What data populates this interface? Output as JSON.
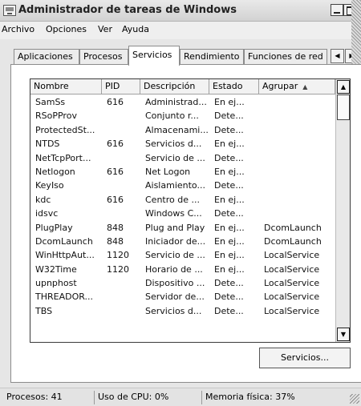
{
  "window": {
    "title": "Administrador de tareas de Windows",
    "controls": {
      "minimize": "",
      "maximize": "",
      "close": "X"
    }
  },
  "menu": [
    "Archivo",
    "Opciones",
    "Ver",
    "Ayuda"
  ],
  "tabs": {
    "items": [
      "Aplicaciones",
      "Procesos",
      "Servicios",
      "Rendimiento",
      "Funciones de red"
    ],
    "active": "Servicios",
    "scroll_left": "◀",
    "scroll_right": "▶"
  },
  "services_table": {
    "headers": [
      "Nombre",
      "PID",
      "Descripción",
      "Estado",
      "Agrupar"
    ],
    "sort_indicator": "▲",
    "rows": [
      [
        "SamSs",
        "616",
        "Administrad...",
        "En ej...",
        ""
      ],
      [
        "RSoPProv",
        "",
        "Conjunto r...",
        "Dete...",
        ""
      ],
      [
        "ProtectedSt...",
        "",
        "Almacenami...",
        "Dete...",
        ""
      ],
      [
        "NTDS",
        "616",
        "Servicios d...",
        "En ej...",
        ""
      ],
      [
        "NetTcpPort...",
        "",
        "Servicio de ...",
        "Dete...",
        ""
      ],
      [
        "Netlogon",
        "616",
        "Net Logon",
        "En ej...",
        ""
      ],
      [
        "KeyIso",
        "",
        "Aislamiento...",
        "Dete...",
        ""
      ],
      [
        "kdc",
        "616",
        "Centro de ...",
        "En ej...",
        ""
      ],
      [
        "idsvc",
        "",
        "Windows C...",
        "Dete...",
        ""
      ],
      [
        "PlugPlay",
        "848",
        "Plug and Play",
        "En ej...",
        "DcomLaunch"
      ],
      [
        "DcomLaunch",
        "848",
        "Iniciador de...",
        "En ej...",
        "DcomLaunch"
      ],
      [
        "WinHttpAut...",
        "1120",
        "Servicio de ...",
        "En ej...",
        "LocalService"
      ],
      [
        "W32Time",
        "1120",
        "Horario de ...",
        "En ej...",
        "LocalService"
      ],
      [
        "upnphost",
        "",
        "Dispositivo ...",
        "Dete...",
        "LocalService"
      ],
      [
        "THREADOR...",
        "",
        "Servidor de...",
        "Dete...",
        "LocalService"
      ],
      [
        "TBS",
        "",
        "Servicios d...",
        "Dete...",
        "LocalService"
      ]
    ],
    "scroll_up": "▲",
    "scroll_down": "▼"
  },
  "services_button": "Servicios...",
  "status": {
    "processes": "Procesos: 41",
    "cpu": "Uso de CPU: 0%",
    "memory": "Memoria física: 37%"
  }
}
